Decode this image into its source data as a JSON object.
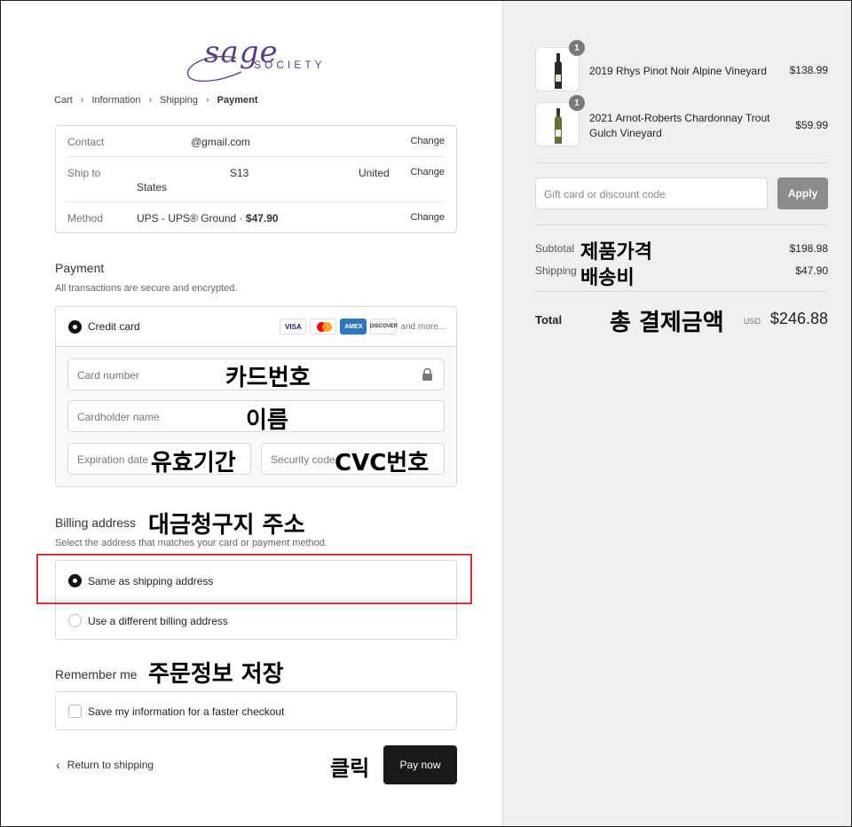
{
  "brand": {
    "script": "sage",
    "word": "SOCIETY"
  },
  "breadcrumbs": [
    {
      "label": "Cart"
    },
    {
      "label": "Information"
    },
    {
      "label": "Shipping"
    },
    {
      "label": "Payment"
    }
  ],
  "summary": {
    "contact_label": "Contact",
    "contact_value": "@gmail.com",
    "ship_label": "Ship to",
    "ship_value_a": "S13",
    "ship_value_b": "United",
    "ship_value_c": "States",
    "method_label": "Method",
    "method_value": "UPS - UPS® Ground · ",
    "method_price": "$47.90",
    "change_label": "Change"
  },
  "payment": {
    "title": "Payment",
    "subtitle": "All transactions are secure and encrypted.",
    "credit_card_label": "Credit card",
    "card_brands": [
      "VISA",
      "AMEX",
      "DISCOVER"
    ],
    "and_more": "and more...",
    "card_number_placeholder": "Card number",
    "cardholder_placeholder": "Cardholder name",
    "expiration_placeholder": "Expiration date",
    "security_placeholder": "Security code"
  },
  "billing": {
    "title": "Billing address",
    "subtitle": "Select the address that matches your card or payment method.",
    "same_label": "Same as shipping address",
    "different_label": "Use a different billing address"
  },
  "remember": {
    "title": "Remember me",
    "save_label": "Save my information for a faster checkout"
  },
  "actions": {
    "back_label": "Return to shipping",
    "pay_label": "Pay now"
  },
  "annotations": {
    "card_number": "카드번호",
    "name": "이름",
    "expiration": "유효기간",
    "cvc": "CVC번호",
    "billing": "대금청구지 주소",
    "remember": "주문정보 저장",
    "click": "클릭",
    "subtotal": "제품가격",
    "shipping": "배송비",
    "total": "총 결제금액"
  },
  "cart": {
    "items": [
      {
        "qty": "1",
        "name": "2019 Rhys Pinot Noir Alpine Vineyard",
        "price": "$138.99"
      },
      {
        "qty": "1",
        "name": "2021 Arnot-Roberts Chardonnay Trout Gulch Vineyard",
        "price": "$59.99"
      }
    ],
    "discount_placeholder": "Gift card or discount code",
    "apply_label": "Apply",
    "subtotal_label": "Subtotal",
    "subtotal_value": "$198.98",
    "shipping_label": "Shipping",
    "shipping_value": "$47.90",
    "total_label": "Total",
    "currency": "USD",
    "total_value": "$246.88"
  },
  "colors": {
    "brand": "#5a3f7e",
    "highlight": "#c6363a",
    "button": "#1a1a1a"
  }
}
